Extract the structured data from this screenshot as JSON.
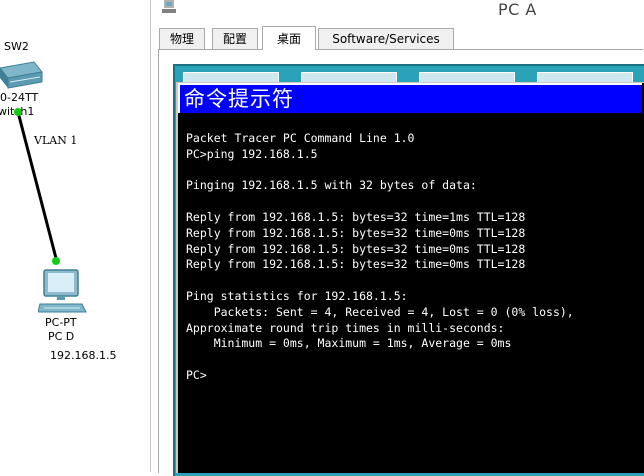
{
  "topology": {
    "switch_name": "SW2",
    "switch_model_partial": "0-24TT",
    "switch_sub_partial": "witch1",
    "link_label": "VLAN 1",
    "pc_type": "PC-PT",
    "pc_name": "PC D",
    "pc_ip": "192.168.1.5",
    "link_color": "#000000",
    "port_color": "#11cc11"
  },
  "window": {
    "title": "PC A",
    "tabs": [
      {
        "label": "物理",
        "active": false
      },
      {
        "label": "配置",
        "active": false
      },
      {
        "label": "桌面",
        "active": true
      },
      {
        "label": "Software/Services",
        "active": false
      }
    ]
  },
  "command_prompt": {
    "title": "命令提示符",
    "title_bar_color": "#0000ff",
    "lines": [
      "Packet Tracer PC Command Line 1.0",
      "PC>ping 192.168.1.5",
      "",
      "Pinging 192.168.1.5 with 32 bytes of data:",
      "",
      "Reply from 192.168.1.5: bytes=32 time=1ms TTL=128",
      "Reply from 192.168.1.5: bytes=32 time=0ms TTL=128",
      "Reply from 192.168.1.5: bytes=32 time=0ms TTL=128",
      "Reply from 192.168.1.5: bytes=32 time=0ms TTL=128",
      "",
      "Ping statistics for 192.168.1.5:",
      "    Packets: Sent = 4, Received = 4, Lost = 0 (0% loss),",
      "Approximate round trip times in milli-seconds:",
      "    Minimum = 0ms, Maximum = 1ms, Average = 0ms",
      "",
      "PC>"
    ]
  }
}
